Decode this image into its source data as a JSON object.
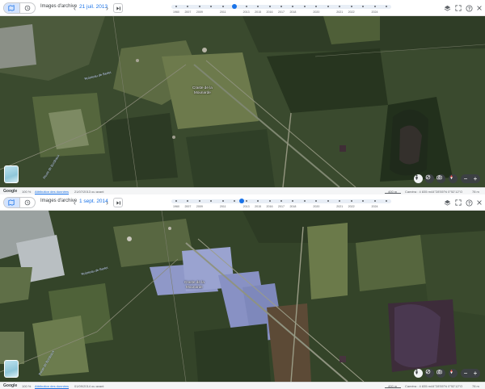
{
  "panes": [
    {
      "id": "top",
      "toolbar": {
        "label": "Images d'archive",
        "date": "21 juil. 2013",
        "prev_glyph": "‹",
        "next_glyph": "›"
      },
      "timeline": {
        "years": [
          "1960",
          "2007",
          "2009",
          "2011",
          "2013",
          "2015",
          "2016",
          "2017",
          "2018",
          "2020",
          "2021",
          "2022",
          "2024"
        ],
        "selected_year": "2014"
      },
      "map": {
        "place_label_line1": "Craste de la",
        "place_label_line2": "Mounarde",
        "road_label_1": "Ruisseau de Berlet",
        "road_label_2": "Route de Bordeaux"
      },
      "status": {
        "brand": "Google",
        "zoom": "100 %",
        "attribution": "Attribution des données",
        "imagery_date": "21/07/2013 ou avant",
        "scale": "400 m",
        "camera": "Caméra : 4 835 m",
        "coords": "44°28'55\"N 0°52'12\"O",
        "elevation": "78 m"
      }
    },
    {
      "id": "bottom",
      "toolbar": {
        "label": "Images d'archive",
        "date": "1 sept. 2014",
        "prev_glyph": "‹",
        "next_glyph": "›"
      },
      "timeline": {
        "years": [
          "1960",
          "2007",
          "2009",
          "2011",
          "2013",
          "2015",
          "2016",
          "2017",
          "2018",
          "2020",
          "2021",
          "2022",
          "2024"
        ],
        "selected_year": "2014"
      },
      "map": {
        "place_label_line1": "Craste de la",
        "place_label_line2": "Mounarde",
        "road_label_1": "Ruisseau de Berlet",
        "road_label_2": "Route de Bordeaux"
      },
      "status": {
        "brand": "Google",
        "zoom": "100 %",
        "attribution": "Attribution des données",
        "imagery_date": "01/09/2014 ou avant",
        "scale": "400 m",
        "camera": "Caméra : 4 835 m",
        "coords": "44°28'55\"N 0°52'12\"O",
        "elevation": "78 m"
      }
    }
  ],
  "colors": {
    "accent": "#1a73e8",
    "forest_dark": "#23331f",
    "field": "#5f6e44",
    "solar_panels": "#8c96c8",
    "burn_scar": "#3a2d33"
  },
  "icons": {
    "view_map": "map-icon",
    "view_history": "history-icon",
    "last_date": "skip-to-latest-icon",
    "layers": "layers-icon",
    "fullscreen": "expand-icon",
    "help": "help-icon",
    "close": "close-icon",
    "pegman": "street-view-icon",
    "tilt": "tilt-icon",
    "camera": "camera-icon",
    "compass": "compass-icon"
  }
}
